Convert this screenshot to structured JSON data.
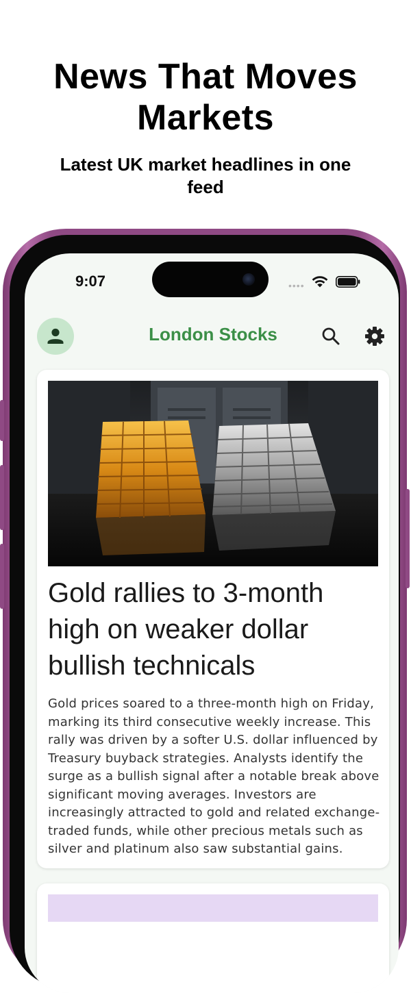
{
  "promo": {
    "title": "News That Moves Markets",
    "subtitle": "Latest UK market headlines in one feed"
  },
  "status_bar": {
    "time": "9:07",
    "signal_dots": "••••",
    "icons": [
      "wifi-icon",
      "battery-icon"
    ]
  },
  "app_bar": {
    "title": "London Stocks",
    "title_color": "#3b8f47",
    "avatar_bg": "#c7e6cc",
    "icons": [
      "person-icon",
      "search-icon",
      "gear-icon"
    ]
  },
  "articles": [
    {
      "image": "gold-and-silver-bars-image",
      "headline": "Gold rallies to 3-month high on weaker dollar bullish technicals",
      "summary": "Gold prices soared to a three-month high on Friday, marking its third consecutive weekly increase. This rally was driven by a softer U.S. dollar influenced by Treasury buyback strategies. Analysts identify the surge as a bullish signal after a notable break above significant moving averages. Investors are increasingly attracted to gold and related exchange-traded funds, while other precious metals such as silver and platinum also saw substantial gains."
    }
  ],
  "frame_color": "#8f4a84"
}
